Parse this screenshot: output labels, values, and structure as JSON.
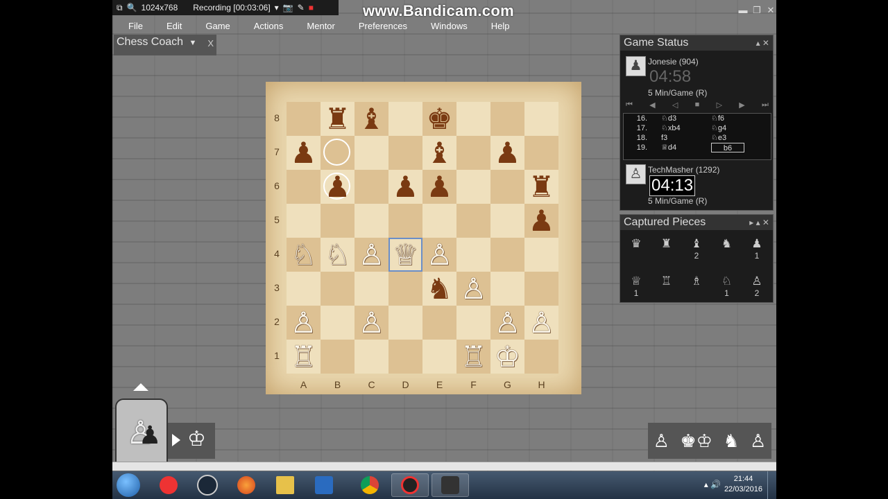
{
  "recorder": {
    "resolution": "1024x768",
    "status": "Recording [00:03:06]",
    "watermark": "www.Bandicam.com"
  },
  "menu": [
    "File",
    "Edit",
    "Game",
    "Actions",
    "Mentor",
    "Preferences",
    "Windows",
    "Help"
  ],
  "coach_tab": {
    "title": "Chess Coach",
    "close": "X"
  },
  "board": {
    "ranks": [
      "8",
      "7",
      "6",
      "5",
      "4",
      "3",
      "2",
      "1"
    ],
    "files": [
      "A",
      "B",
      "C",
      "D",
      "E",
      "F",
      "G",
      "H"
    ],
    "pieces": [
      {
        "sq": "b8",
        "glyph": "♜",
        "color": "b"
      },
      {
        "sq": "c8",
        "glyph": "♝",
        "color": "b"
      },
      {
        "sq": "e8",
        "glyph": "♚",
        "color": "b"
      },
      {
        "sq": "a7",
        "glyph": "♟",
        "color": "b"
      },
      {
        "sq": "e7",
        "glyph": "♝",
        "color": "b"
      },
      {
        "sq": "g7",
        "glyph": "♟",
        "color": "b"
      },
      {
        "sq": "b6",
        "glyph": "♟",
        "color": "b"
      },
      {
        "sq": "d6",
        "glyph": "♟",
        "color": "b"
      },
      {
        "sq": "e6",
        "glyph": "♟",
        "color": "b"
      },
      {
        "sq": "h6",
        "glyph": "♜",
        "color": "b"
      },
      {
        "sq": "h5",
        "glyph": "♟",
        "color": "b"
      },
      {
        "sq": "a4",
        "glyph": "♘",
        "color": "w"
      },
      {
        "sq": "b4",
        "glyph": "♘",
        "color": "w"
      },
      {
        "sq": "c4",
        "glyph": "♙",
        "color": "w"
      },
      {
        "sq": "d4",
        "glyph": "♕",
        "color": "w"
      },
      {
        "sq": "e4",
        "glyph": "♙",
        "color": "w"
      },
      {
        "sq": "e3",
        "glyph": "♞",
        "color": "b"
      },
      {
        "sq": "f3",
        "glyph": "♙",
        "color": "w"
      },
      {
        "sq": "a2",
        "glyph": "♙",
        "color": "w"
      },
      {
        "sq": "c2",
        "glyph": "♙",
        "color": "w"
      },
      {
        "sq": "g2",
        "glyph": "♙",
        "color": "w"
      },
      {
        "sq": "h2",
        "glyph": "♙",
        "color": "w"
      },
      {
        "sq": "a1",
        "glyph": "♖",
        "color": "w"
      },
      {
        "sq": "f1",
        "glyph": "♖",
        "color": "w"
      },
      {
        "sq": "g1",
        "glyph": "♔",
        "color": "w"
      }
    ],
    "highlight": "d4",
    "rings": [
      "b7",
      "b6"
    ]
  },
  "game_status": {
    "title": "Game Status",
    "top_player": {
      "name": "Jonesie (904)",
      "clock": "04:58",
      "type": "5 Min/Game (R)"
    },
    "bottom_player": {
      "name": "TechMasher (1292)",
      "clock": "04:13",
      "type": "5 Min/Game (R)"
    },
    "moves": [
      {
        "n": "16.",
        "w": "♘d3",
        "b": "♘f6"
      },
      {
        "n": "17.",
        "w": "♘xb4",
        "b": "♘g4"
      },
      {
        "n": "18.",
        "w": "f3",
        "b": "♘e3"
      },
      {
        "n": "19.",
        "w": "♕d4",
        "b": "b6"
      }
    ]
  },
  "captured": {
    "title": "Captured Pieces",
    "top": [
      {
        "glyph": "♛",
        "count": ""
      },
      {
        "glyph": "♜",
        "count": ""
      },
      {
        "glyph": "♝",
        "count": "2"
      },
      {
        "glyph": "♞",
        "count": ""
      },
      {
        "glyph": "♟",
        "count": "1"
      }
    ],
    "bottom": [
      {
        "glyph": "♕",
        "count": "1"
      },
      {
        "glyph": "♖",
        "count": ""
      },
      {
        "glyph": "♗",
        "count": ""
      },
      {
        "glyph": "♘",
        "count": "1"
      },
      {
        "glyph": "♙",
        "count": "2"
      }
    ]
  },
  "clock": {
    "time": "21:44",
    "date": "22/03/2016"
  },
  "colors": {
    "accent": "#6a8ec8",
    "dark_piece": "#7a3a12"
  }
}
